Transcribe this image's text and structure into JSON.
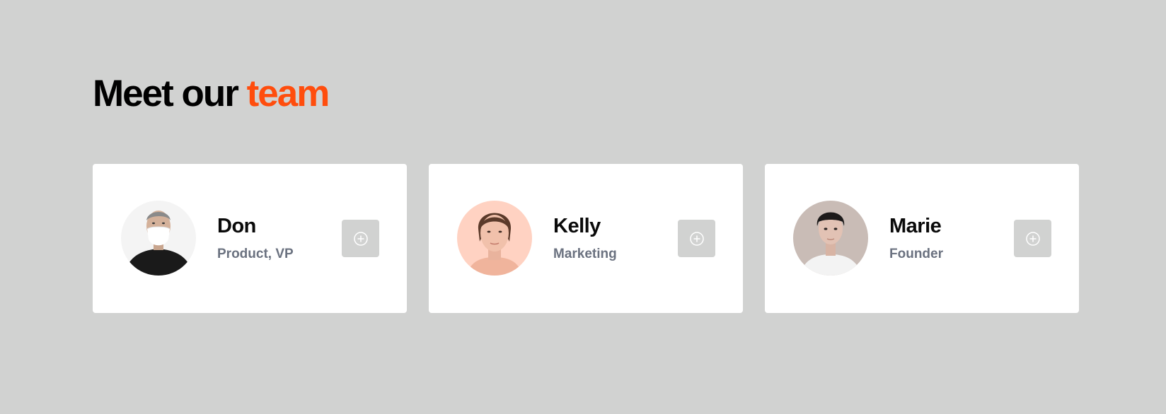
{
  "heading": {
    "text": "Meet our",
    "accent": "team",
    "accent_color": "#ff4d0d"
  },
  "colors": {
    "background": "#d1d2d1",
    "card": "#ffffff",
    "name": "#0a0a0a",
    "role": "#6b7280"
  },
  "team": [
    {
      "name": "Don",
      "role": "Product, VP",
      "add_icon": "plus-circle-icon"
    },
    {
      "name": "Kelly",
      "role": "Marketing",
      "add_icon": "plus-circle-icon"
    },
    {
      "name": "Marie",
      "role": "Founder",
      "add_icon": "plus-circle-icon"
    }
  ]
}
